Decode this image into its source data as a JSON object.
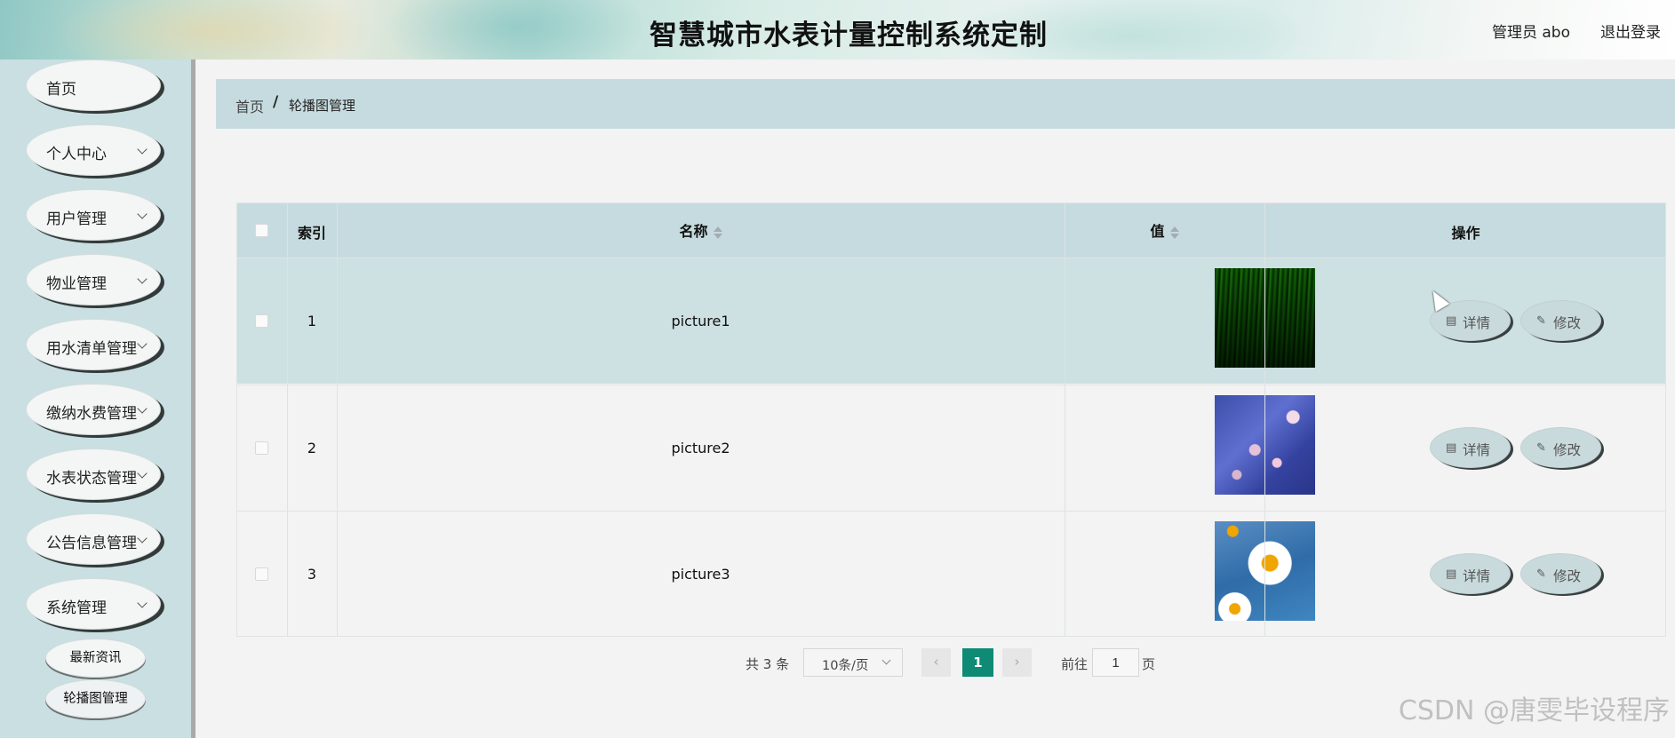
{
  "header": {
    "title": "智慧城市水表计量控制系统定制",
    "user": "管理员 abo",
    "logout": "退出登录"
  },
  "sidebar": {
    "items": [
      {
        "label": "首页",
        "chevron": false
      },
      {
        "label": "个人中心",
        "chevron": true
      },
      {
        "label": "用户管理",
        "chevron": true
      },
      {
        "label": "物业管理",
        "chevron": true
      },
      {
        "label": "用水清单管理",
        "chevron": true
      },
      {
        "label": "缴纳水费管理",
        "chevron": true
      },
      {
        "label": "水表状态管理",
        "chevron": true
      },
      {
        "label": "公告信息管理",
        "chevron": true
      },
      {
        "label": "系统管理",
        "chevron": true
      }
    ],
    "sub_items": [
      "最新资讯",
      "轮播图管理"
    ]
  },
  "breadcrumb": {
    "home": "首页",
    "separator": "/",
    "current": "轮播图管理"
  },
  "table": {
    "headers": {
      "index": "索引",
      "name": "名称",
      "value": "值",
      "actions": "操作"
    },
    "rows": [
      {
        "index": "1",
        "name": "picture1",
        "image": "green-grass"
      },
      {
        "index": "2",
        "name": "picture2",
        "image": "blue-blossoms"
      },
      {
        "index": "3",
        "name": "picture3",
        "image": "daisies-on-blue"
      }
    ],
    "detail_label": "详情",
    "edit_label": "修改"
  },
  "pagination": {
    "total": "共 3 条",
    "page_size": "10条/页",
    "prev": "‹",
    "current_page": "1",
    "next": "›",
    "goto_label": "前往",
    "goto_value": "1",
    "page_suffix": "页"
  },
  "watermark": "CSDN @唐雯毕设程序",
  "colors": {
    "sidebar": "#c9dfe1",
    "header_bar": "#c6dbdf",
    "row_highlight": "#cde0e2",
    "active_page": "#0f8a74"
  }
}
